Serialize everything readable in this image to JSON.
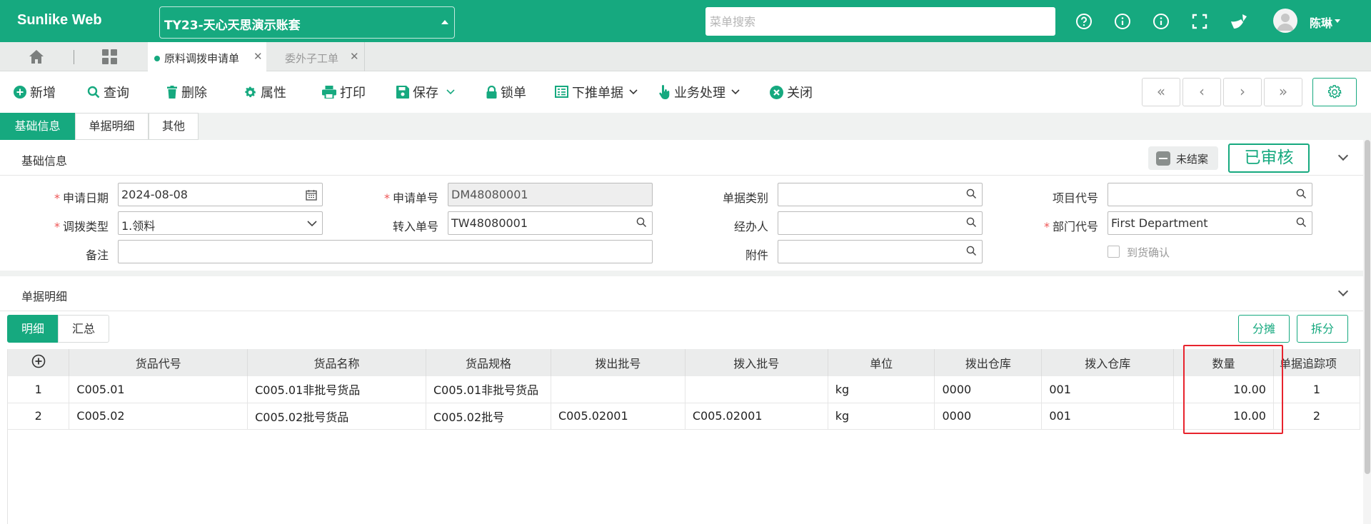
{
  "app": {
    "brand": "Sunlike Web",
    "account": "TY23-天心天思演示账套",
    "menu_search_placeholder": "菜单搜索",
    "user_name": "陈琳"
  },
  "topbar_icons": [
    "help-icon",
    "info-icon",
    "info-icon",
    "fullscreen-icon",
    "broom-icon"
  ],
  "tabs": [
    {
      "label": "原料调拨申请单",
      "active": true
    },
    {
      "label": "委外子工单",
      "active": false
    }
  ],
  "toolbar": {
    "new": "新增",
    "query": "查询",
    "delete": "删除",
    "properties": "属性",
    "print": "打印",
    "save": "保存",
    "lock": "锁单",
    "push_down": "下推单据",
    "business": "业务处理",
    "close": "关闭"
  },
  "section_tabs": [
    "基础信息",
    "单据明细",
    "其他"
  ],
  "basic": {
    "title": "基础信息",
    "status_open": "未结案",
    "status_audit": "已审核",
    "labels": {
      "apply_date": "申请日期",
      "apply_no": "申请单号",
      "doc_type": "单据类别",
      "project_code": "项目代号",
      "transfer_type": "调拨类型",
      "in_no": "转入单号",
      "handler": "经办人",
      "dept_code": "部门代号",
      "remark": "备注",
      "attachment": "附件",
      "arrival_confirm": "到货确认"
    },
    "values": {
      "apply_date": "2024-08-08",
      "apply_no": "DM48080001",
      "doc_type": "",
      "project_code": "",
      "transfer_type": "1.领料",
      "in_no": "TW48080001",
      "handler": "",
      "dept_code": "First Department",
      "remark": "",
      "attachment": ""
    }
  },
  "detail": {
    "title": "单据明细",
    "tabs": [
      "明细",
      "汇总"
    ],
    "actions": {
      "split_alloc": "分摊",
      "split": "拆分"
    },
    "columns": [
      "货品代号",
      "货品名称",
      "货品规格",
      "拨出批号",
      "拨入批号",
      "单位",
      "拨出仓库",
      "拨入仓库",
      "数量",
      "单据追踪项"
    ],
    "rows": [
      {
        "no": "1",
        "code": "C005.01",
        "name": "C005.01非批号货品",
        "spec": "C005.01非批号货品",
        "out_batch": "",
        "in_batch": "",
        "unit": "kg",
        "out_wh": "0000",
        "in_wh": "001",
        "qty": "10.00",
        "trace": "1"
      },
      {
        "no": "2",
        "code": "C005.02",
        "name": "C005.02批号货品",
        "spec": "C005.02批号",
        "out_batch": "C005.02001",
        "in_batch": "C005.02001",
        "unit": "kg",
        "out_wh": "0000",
        "in_wh": "001",
        "qty": "10.00",
        "trace": "2"
      }
    ]
  },
  "colors": {
    "accent": "#16a97f",
    "highlight": "#e8232d",
    "required": "#e55555"
  }
}
